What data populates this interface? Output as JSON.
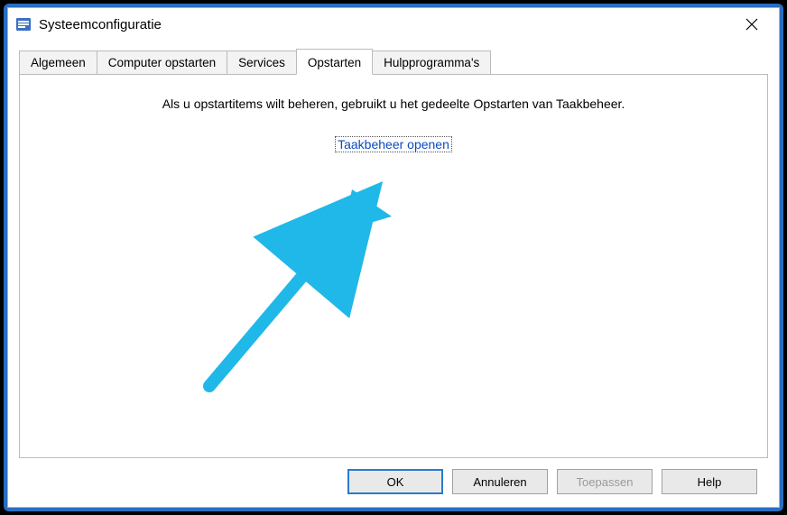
{
  "window": {
    "title": "Systeemconfiguratie"
  },
  "tabs": [
    {
      "label": "Algemeen",
      "active": false
    },
    {
      "label": "Computer opstarten",
      "active": false
    },
    {
      "label": "Services",
      "active": false
    },
    {
      "label": "Opstarten",
      "active": true
    },
    {
      "label": "Hulpprogramma's",
      "active": false
    }
  ],
  "content": {
    "info_text": "Als u opstartitems wilt beheren, gebruikt u het gedeelte Opstarten van Taakbeheer.",
    "link_label": "Taakbeheer openen"
  },
  "buttons": {
    "ok": "OK",
    "cancel": "Annuleren",
    "apply": "Toepassen",
    "help": "Help"
  },
  "annotation": {
    "arrow_color": "#20b8e8"
  }
}
